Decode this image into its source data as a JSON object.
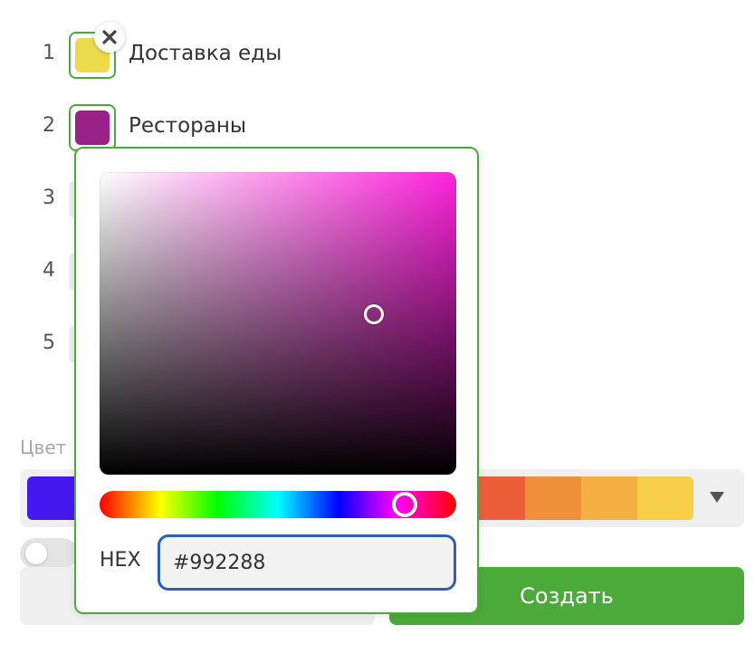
{
  "categories": [
    {
      "number": "1",
      "label": "Доставка еды",
      "color": "#ecdc4c"
    },
    {
      "number": "2",
      "label": "Рестораны",
      "color": "#992288"
    },
    {
      "number": "3"
    },
    {
      "number": "4"
    },
    {
      "number": "5"
    }
  ],
  "remove_icon": "close-icon",
  "color_section": {
    "label": "Цвет",
    "palette_colors": [
      "#4717f0",
      "#eb4a3d",
      "#ec5e3a",
      "#f0903a",
      "#f4b040",
      "#f8cf48"
    ],
    "dropdown_icon": "triangle-down-icon"
  },
  "toggle": {
    "on": false
  },
  "buttons": {
    "create_label": "Создать"
  },
  "picker": {
    "hue_color": "#ff22dd",
    "hex_label": "HEX",
    "hex_value": "#992288"
  }
}
